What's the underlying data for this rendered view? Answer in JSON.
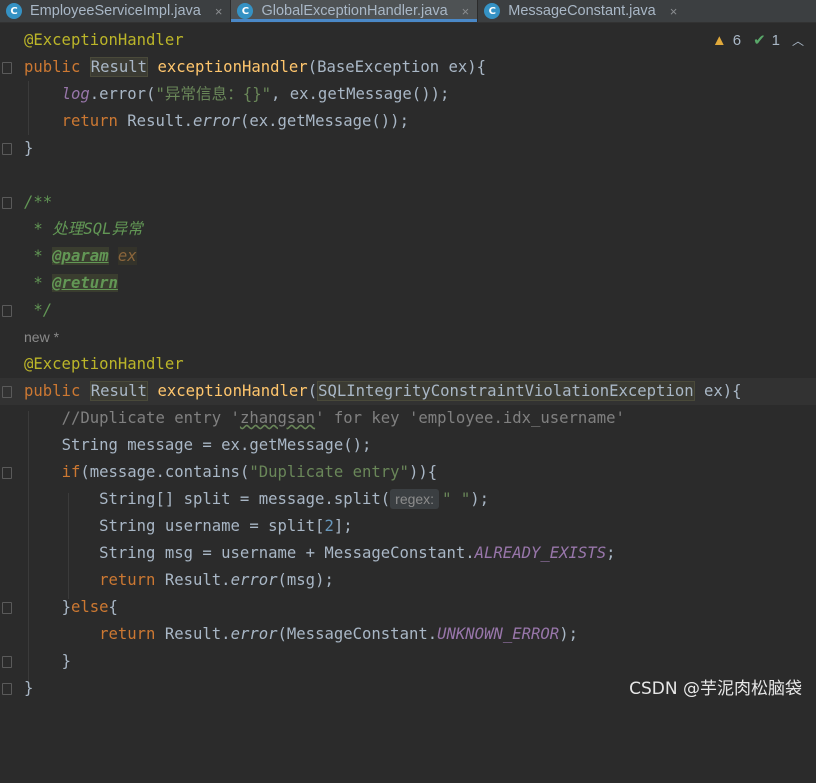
{
  "tabs": [
    {
      "label": "EmployeeServiceImpl.java",
      "icon": "C",
      "active": false
    },
    {
      "label": "GlobalExceptionHandler.java",
      "icon": "C",
      "active": true
    },
    {
      "label": "MessageConstant.java",
      "icon": "C",
      "active": false
    }
  ],
  "tab_close": "×",
  "inspections": {
    "warnings": "6",
    "weak_warnings": "1"
  },
  "code": {
    "l1_ann": "@ExceptionHandler",
    "l2_kw": "public",
    "l2_type": "Result",
    "l2_fn": "exceptionHandler",
    "l2_rest": "(BaseException ex){",
    "l3_log": "log",
    "l3_rest1": ".error(",
    "l3_str": "\"异常信息：{}\"",
    "l3_rest2": ", ex.getMessage());",
    "l4_kw": "return",
    "l4_rest1": " Result.",
    "l4_method": "error",
    "l4_rest2": "(ex.getMessage());",
    "l5": "}",
    "l7": "/**",
    "l8": " * 处理SQL异常",
    "l9_pre": " * ",
    "l9_tag": "@param",
    "l9_val": "ex",
    "l10_pre": " * ",
    "l10_tag": "@return",
    "l11": " */",
    "l12_new": "new *",
    "l13_ann": "@ExceptionHandler",
    "l14_kw": "public",
    "l14_type": "Result",
    "l14_fn": "exceptionHandler",
    "l14_paren": "(",
    "l14_exc": "SQLIntegrityConstraintViolationException",
    "l14_rest": " ex){",
    "l15_c1": "//Duplicate entry '",
    "l15_c2": "zhangsan",
    "l15_c3": "' for key 'employee.idx_username'",
    "l16": "String message = ex.getMessage();",
    "l17_kw": "if",
    "l17_rest1": "(message.contains(",
    "l17_str": "\"Duplicate entry\"",
    "l17_rest2": ")){",
    "l18_rest1": "String[] split = message.split(",
    "l18_hint": "regex:",
    "l18_str": "\" \"",
    "l18_rest2": ");",
    "l19_rest1": "String username = split[",
    "l19_num": "2",
    "l19_rest2": "];",
    "l20_rest1": "String msg = username + MessageConstant.",
    "l20_const": "ALREADY_EXISTS",
    "l20_rest2": ";",
    "l21_kw": "return",
    "l21_rest1": " Result.",
    "l21_method": "error",
    "l21_rest2": "(msg);",
    "l22_rest1": "}",
    "l22_kw": "else",
    "l22_rest2": "{",
    "l23_kw": "return",
    "l23_rest1": " Result.",
    "l23_method": "error",
    "l23_rest2": "(MessageConstant.",
    "l23_const": "UNKNOWN_ERROR",
    "l23_rest3": ");",
    "l24": "}",
    "l25": "}"
  },
  "watermark": "CSDN @芋泥肉松脑袋",
  "colors": {
    "keyword": "#cc7832",
    "string": "#6a8759",
    "annotation": "#bbb529",
    "function": "#ffc66d",
    "constant": "#9876aa",
    "comment": "#808080",
    "background": "#2b2b2b"
  }
}
